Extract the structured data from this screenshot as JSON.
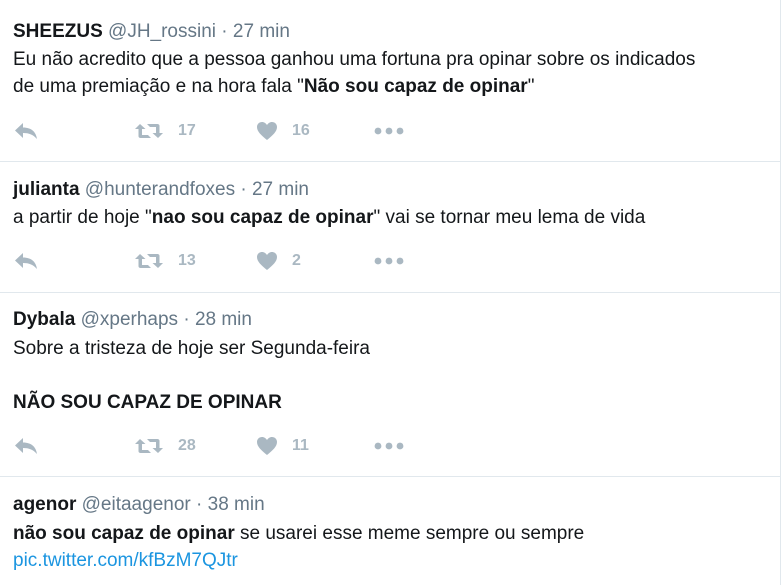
{
  "tweets": [
    {
      "name": "SHEEZUS",
      "handle": "@JH_rossini",
      "separator": "·",
      "time": "27 min",
      "line1": "Eu não acredito que a pessoa ganhou uma fortuna pra opinar sobre os indicados",
      "line2_pre": "de uma premiação e na hora fala \"",
      "line2_bold": "Não sou capaz de opinar",
      "line2_post": "\"",
      "retweets": "17",
      "likes": "16"
    },
    {
      "name": "julianta",
      "handle": "@hunterandfoxes",
      "separator": "·",
      "time": "27 min",
      "line1_pre": "a partir de hoje \"",
      "line1_bold": "nao sou capaz de opinar",
      "line1_post": "\" vai se tornar meu lema de vida",
      "retweets": "13",
      "likes": "2"
    },
    {
      "name": "Dybala",
      "handle": "@xperhaps",
      "separator": "·",
      "time": "28 min",
      "line1": "Sobre a tristeza de hoje ser Segunda-feira",
      "line3_bold": "NÃO SOU CAPAZ DE OPINAR",
      "retweets": "28",
      "likes": "11"
    },
    {
      "name": "agenor",
      "handle": "@eitaagenor",
      "separator": "·",
      "time": "38 min",
      "line1_bold": "não sou capaz de opinar",
      "line1_post": " se usarei esse meme sempre ou sempre",
      "link": "pic.twitter.com/kfBzM7QJtr"
    }
  ],
  "icons": {
    "reply": "reply-icon",
    "retweet": "retweet-icon",
    "like": "heart-icon",
    "more": "more-icon"
  },
  "colors": {
    "name": "#14171a",
    "meta": "#657786",
    "action": "#aab8c2",
    "link": "#1b95e0",
    "divider": "#e1e8ed"
  }
}
